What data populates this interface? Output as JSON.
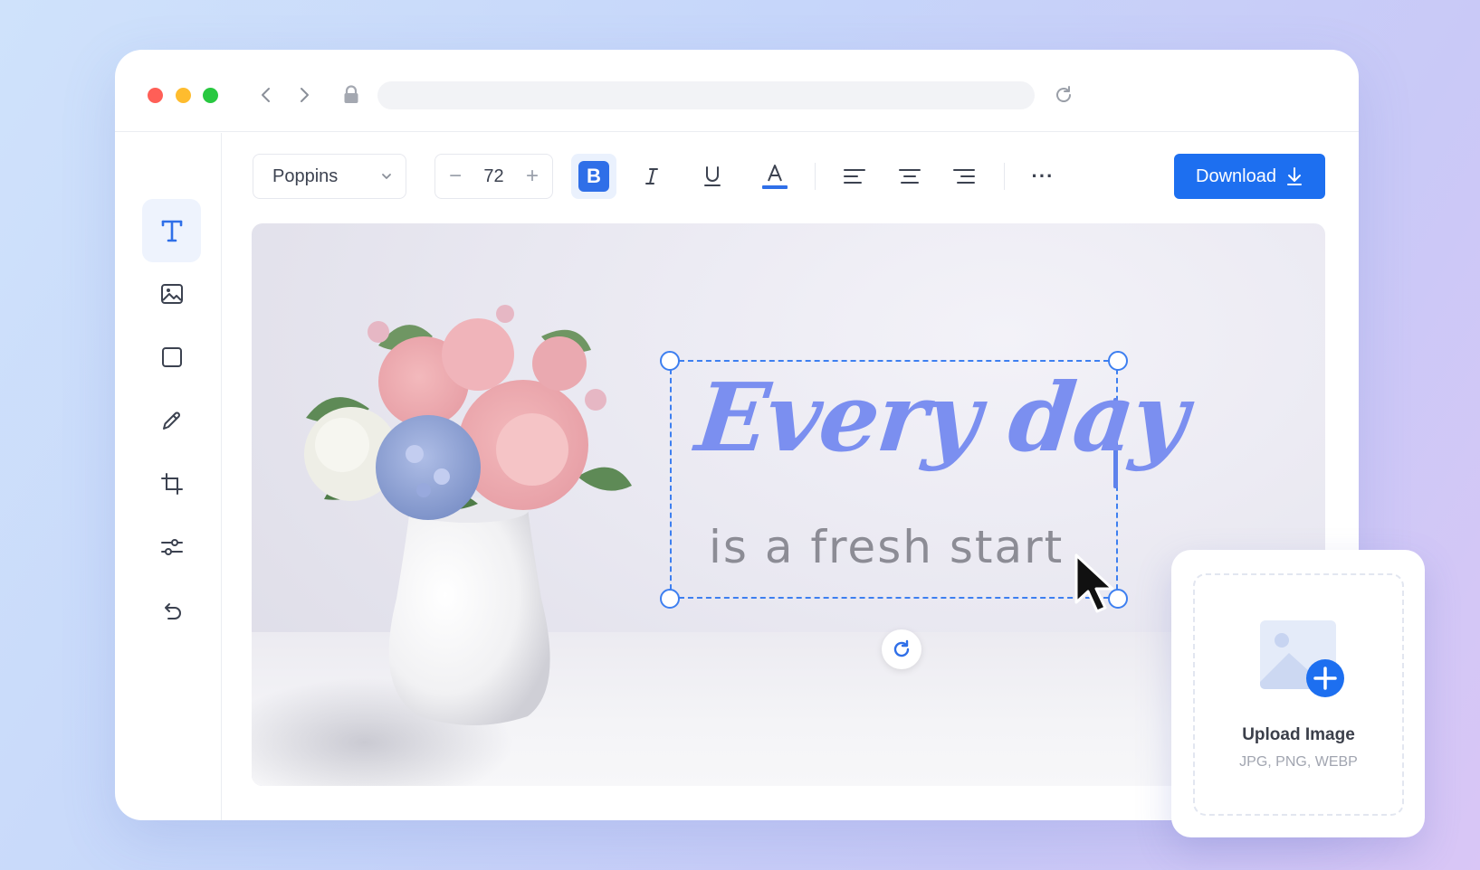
{
  "toolbar": {
    "font_family": "Poppins",
    "font_size": "72",
    "decrease_label": "−",
    "increase_label": "+",
    "bold_label": "B",
    "more_label": "···",
    "download_label": "Download"
  },
  "sidebar": {
    "items": [
      {
        "name": "text",
        "icon": "text-icon",
        "active": true
      },
      {
        "name": "image",
        "icon": "image-icon"
      },
      {
        "name": "shape",
        "icon": "square-icon"
      },
      {
        "name": "draw",
        "icon": "pencil-icon"
      },
      {
        "name": "crop",
        "icon": "crop-icon"
      },
      {
        "name": "adjust",
        "icon": "sliders-icon"
      },
      {
        "name": "undo",
        "icon": "undo-icon"
      }
    ]
  },
  "canvas": {
    "headline": "Every day",
    "subline": "is a fresh start"
  },
  "upload": {
    "title": "Upload Image",
    "formats": "JPG, PNG, WEBP"
  },
  "colors": {
    "accent": "#1d6ff0",
    "headline": "#7b8ff0",
    "selection": "#3d7ff0"
  }
}
